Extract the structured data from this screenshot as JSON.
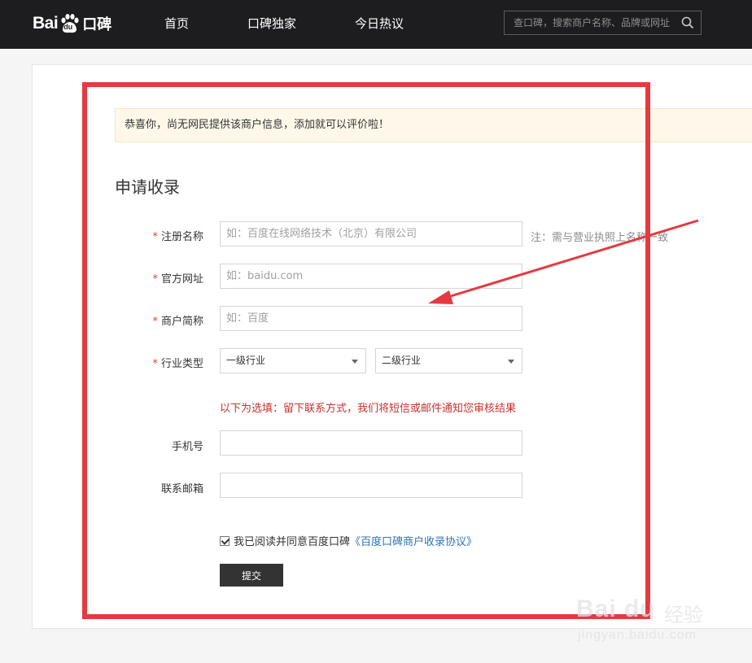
{
  "header": {
    "logo_text_a": "Bai",
    "logo_text_du": "du",
    "logo_text_b": "口碑",
    "nav": [
      "首页",
      "口碑独家",
      "今日热议"
    ],
    "search_placeholder": "查口碑，搜索商户名称、品牌或网址"
  },
  "notice": "恭喜你，尚无网民提供该商户信息，添加就可以评价啦！",
  "form": {
    "title": "申请收录",
    "required_mark": "*",
    "fields": [
      {
        "label": "注册名称",
        "placeholder": "如：百度在线网络技术（北京）有限公司",
        "value": "",
        "required": true
      },
      {
        "label": "官方网址",
        "placeholder": "如：baidu.com",
        "value": "",
        "required": true
      },
      {
        "label": "商户简称",
        "placeholder": "如：百度",
        "value": "",
        "required": true
      }
    ],
    "name_hint": "注：需与营业执照上名称一致",
    "industry": {
      "label": "行业类型",
      "level1": "一级行业",
      "level2": "二级行业"
    },
    "optional_note": "以下为选填：留下联系方式，我们将短信或邮件通知您审核结果",
    "phone_label": "手机号",
    "phone_value": "",
    "email_label": "联系邮箱",
    "email_value": "",
    "agree_text": "我已阅读并同意百度口碑",
    "agree_link": "《百度口碑商户收录协议》",
    "agree_checked": true,
    "submit_label": "提交"
  },
  "watermark": {
    "brand": "Bai du",
    "cn": "经验",
    "url": "jingyan.baidu.com"
  },
  "colors": {
    "header_bg": "#1d1d1f",
    "annotation_red": "#e53a40",
    "required_red": "#e2452d",
    "link_blue": "#2e73b8",
    "notice_bg": "#fff8ea"
  }
}
